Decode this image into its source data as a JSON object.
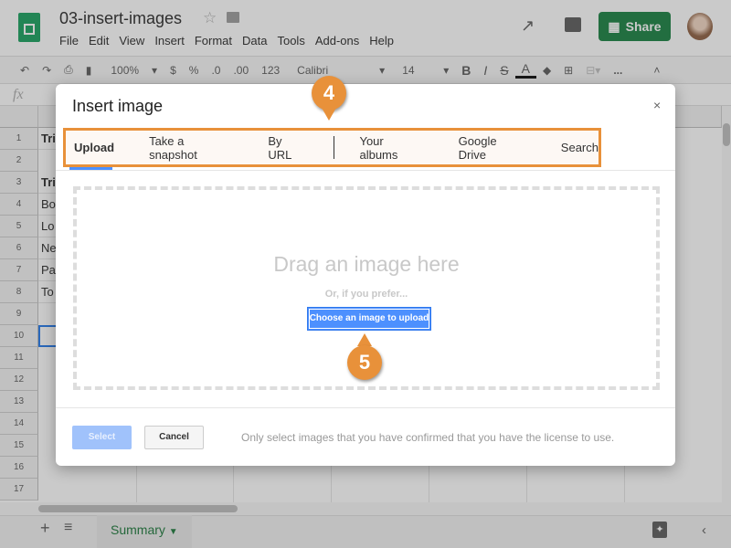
{
  "app": {
    "doc_title": "03-insert-images",
    "menu": [
      "File",
      "Edit",
      "View",
      "Insert",
      "Format",
      "Data",
      "Tools",
      "Add-ons",
      "Help"
    ],
    "share_label": "Share"
  },
  "toolbar": {
    "zoom": "100%",
    "currency": "$",
    "percent": "%",
    "dec_less": ".0",
    "dec_more": ".00",
    "format": "123",
    "font": "Calibri",
    "font_size": "14",
    "bold": "B",
    "italic": "I",
    "strike": "S",
    "text_color": "A",
    "more": "..."
  },
  "formula_bar": {
    "fx": "fx"
  },
  "rows": [
    "1",
    "2",
    "3",
    "4",
    "5",
    "6",
    "7",
    "8",
    "9",
    "10",
    "11",
    "12",
    "13",
    "14",
    "15",
    "16",
    "17"
  ],
  "cells": {
    "r1": "Tri",
    "r3": "Tri",
    "r4": "Bo",
    "r5": "Lo",
    "r6": "Ne",
    "r7": "Pa",
    "r8": "To"
  },
  "sheet_tab": "Summary",
  "dialog": {
    "title": "Insert image",
    "close": "×",
    "tabs": [
      "Upload",
      "Take a snapshot",
      "By URL",
      "Your albums",
      "Google Drive",
      "Search"
    ],
    "selected_tab": "Upload",
    "drag_text": "Drag an image here",
    "prefer_text": "Or, if you prefer...",
    "choose_label": "Choose an image to upload",
    "select_label": "Select",
    "cancel_label": "Cancel",
    "license_note": "Only select images that you have confirmed that you have the license to use."
  },
  "callouts": {
    "step4": "4",
    "step5": "5",
    "color": "#e8913a"
  },
  "colors": {
    "share": "#0f7b3a",
    "accent": "#4d90fe"
  }
}
